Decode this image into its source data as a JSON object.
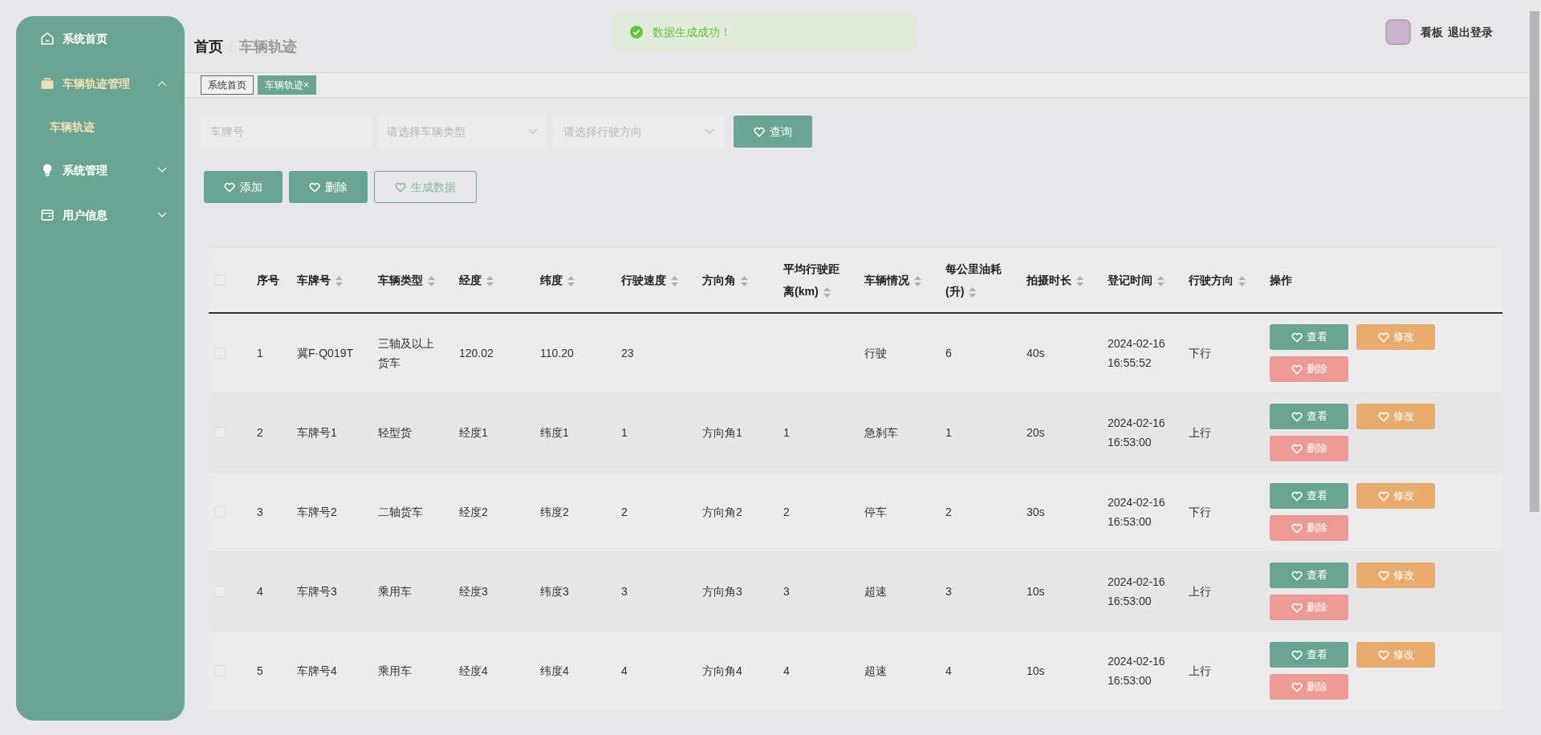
{
  "sidebar": {
    "items": [
      {
        "label": "系统首页"
      },
      {
        "label": "车辆轨迹管理",
        "expanded": true,
        "children": [
          {
            "label": "车辆轨迹",
            "selected": true
          }
        ]
      },
      {
        "label": "系统管理",
        "expanded": false
      },
      {
        "label": "用户信息",
        "expanded": false
      }
    ]
  },
  "breadcrumb": {
    "home": "首页",
    "separator": "ⵗ",
    "current": "车辆轨迹"
  },
  "tabs": [
    {
      "label": "系统首页",
      "selected": false
    },
    {
      "label": "车辆轨迹",
      "selected": true,
      "close": "×"
    }
  ],
  "toast": {
    "message": "数据生成成功！"
  },
  "user": {
    "board": "看板",
    "logout": "退出登录"
  },
  "filters": {
    "plate_placeholder": "车牌号",
    "type_placeholder": "请选择车辆类型",
    "direction_placeholder": "请选择行驶方向",
    "search_button": "查询"
  },
  "toolbar": [
    {
      "label": "添加",
      "kind": "primary"
    },
    {
      "label": "删除",
      "kind": "primary"
    },
    {
      "label": "生成数据",
      "kind": "outline"
    }
  ],
  "table": {
    "header_checked": false,
    "columns": [
      {
        "label": "序号",
        "sortable": false
      },
      {
        "label": "车牌号",
        "sortable": true
      },
      {
        "label": "车辆类型",
        "sortable": true
      },
      {
        "label": "经度",
        "sortable": true
      },
      {
        "label": "纬度",
        "sortable": true
      },
      {
        "label": "行驶速度",
        "sortable": true
      },
      {
        "label": "方向角",
        "sortable": true
      },
      {
        "label": "平均行驶距离(km)",
        "sortable": true
      },
      {
        "label": "车辆情况",
        "sortable": true
      },
      {
        "label": "每公里油耗(升)",
        "sortable": true
      },
      {
        "label": "拍摄时长",
        "sortable": true
      },
      {
        "label": "登记时间",
        "sortable": true
      },
      {
        "label": "行驶方向",
        "sortable": true
      },
      {
        "label": "操作",
        "sortable": false
      }
    ],
    "rows": [
      {
        "checked": false,
        "cells": [
          "1",
          "冀F·Q019T",
          "三轴及以上货车",
          "120.02",
          "110.20",
          "23",
          null,
          null,
          "行驶",
          "6",
          "40s",
          "2024-02-16 16:55:52",
          "下行"
        ],
        "actions": [
          {
            "label": "查看",
            "kind": "view"
          },
          {
            "label": "修改",
            "kind": "edit"
          },
          {
            "label": "删除",
            "kind": "delete"
          }
        ]
      },
      {
        "checked": false,
        "cells": [
          "2",
          "车牌号1",
          "轻型货",
          "经度1",
          "纬度1",
          "1",
          "方向角1",
          "1",
          "急刹车",
          "1",
          "20s",
          "2024-02-16 16:53:00",
          "上行"
        ],
        "actions": [
          {
            "label": "查看",
            "kind": "view"
          },
          {
            "label": "修改",
            "kind": "edit"
          },
          {
            "label": "删除",
            "kind": "delete"
          }
        ]
      },
      {
        "checked": false,
        "cells": [
          "3",
          "车牌号2",
          "二轴货车",
          "经度2",
          "纬度2",
          "2",
          "方向角2",
          "2",
          "停车",
          "2",
          "30s",
          "2024-02-16 16:53:00",
          "下行"
        ],
        "actions": [
          {
            "label": "查看",
            "kind": "view"
          },
          {
            "label": "修改",
            "kind": "edit"
          },
          {
            "label": "删除",
            "kind": "delete"
          }
        ]
      },
      {
        "checked": false,
        "cells": [
          "4",
          "车牌号3",
          "乘用车",
          "经度3",
          "纬度3",
          "3",
          "方向角3",
          "3",
          "超速",
          "3",
          "10s",
          "2024-02-16 16:53:00",
          "上行"
        ],
        "actions": [
          {
            "label": "查看",
            "kind": "view"
          },
          {
            "label": "修改",
            "kind": "edit"
          },
          {
            "label": "删除",
            "kind": "delete"
          }
        ]
      },
      {
        "checked": false,
        "cells": [
          "5",
          "车牌号4",
          "乘用车",
          "经度4",
          "纬度4",
          "4",
          "方向角4",
          "4",
          "超速",
          "4",
          "10s",
          "2024-02-16 16:53:00",
          "上行"
        ],
        "actions": [
          {
            "label": "查看",
            "kind": "view"
          },
          {
            "label": "修改",
            "kind": "edit"
          },
          {
            "label": "删除",
            "kind": "delete"
          }
        ]
      }
    ]
  }
}
